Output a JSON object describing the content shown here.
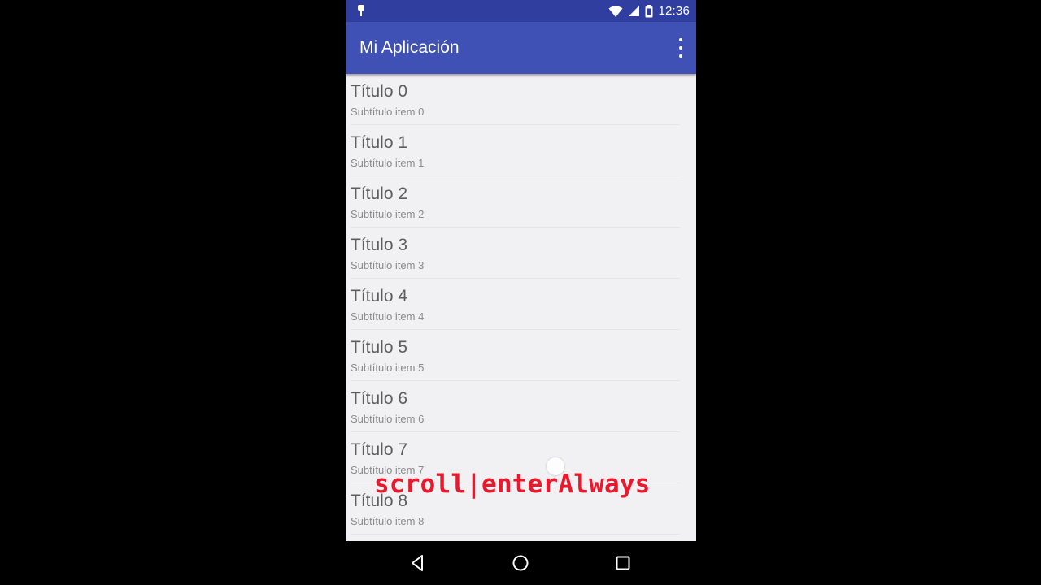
{
  "status_bar": {
    "time": "12:36",
    "icons": [
      "notification-pin-icon",
      "wifi-icon",
      "signal-icon",
      "battery-icon"
    ]
  },
  "app_bar": {
    "title": "Mi Aplicación",
    "overflow_icon": "more-vert-icon",
    "color": "#3f51b5",
    "status_color": "#303f9f"
  },
  "list": {
    "items": [
      {
        "title": "Título 0",
        "subtitle": "Subtítulo item 0"
      },
      {
        "title": "Título 1",
        "subtitle": "Subtítulo item 1"
      },
      {
        "title": "Título 2",
        "subtitle": "Subtítulo item 2"
      },
      {
        "title": "Título 3",
        "subtitle": "Subtítulo item 3"
      },
      {
        "title": "Título 4",
        "subtitle": "Subtítulo item 4"
      },
      {
        "title": "Título 5",
        "subtitle": "Subtítulo item 5"
      },
      {
        "title": "Título 6",
        "subtitle": "Subtítulo item 6"
      },
      {
        "title": "Título 7",
        "subtitle": "Subtítulo item 7"
      },
      {
        "title": "Título 8",
        "subtitle": "Subtítulo item 8"
      }
    ]
  },
  "overlay": {
    "caption": "scroll|enterAlways",
    "caption_color": "#e8192c"
  },
  "nav_bar": {
    "buttons": [
      "back-icon",
      "home-icon",
      "recents-icon"
    ]
  }
}
